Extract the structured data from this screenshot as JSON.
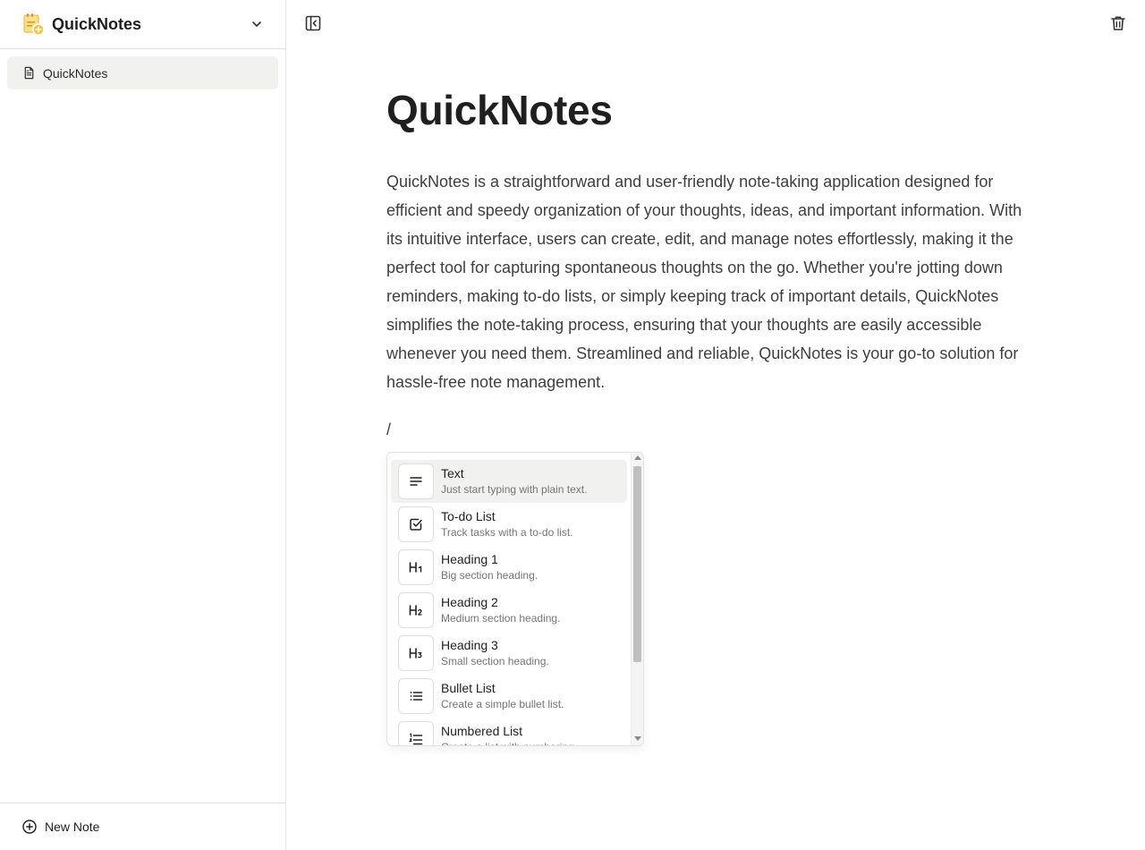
{
  "workspace": {
    "name": "QuickNotes",
    "logo_icon": "notebook-logo-icon",
    "accent": "#f4c542"
  },
  "sidebar": {
    "items": [
      {
        "label": "QuickNotes",
        "icon": "document-icon",
        "selected": true
      }
    ],
    "footer": {
      "label": "New Note",
      "icon": "plus-circle-icon"
    }
  },
  "toolbar": {
    "toggle_sidebar_icon": "sidebar-toggle-icon",
    "delete_icon": "trash-icon"
  },
  "document": {
    "title": "QuickNotes",
    "body": "QuickNotes is a straightforward and user-friendly note-taking application designed for efficient and speedy organization of your thoughts, ideas, and important information. With its intuitive interface, users can create, edit, and manage notes effortlessly, making it the perfect tool for capturing spontaneous thoughts on the go. Whether you're jotting down reminders, making to-do lists, or simply keeping track of important details, QuickNotes simplifies the note-taking process, ensuring that your thoughts are easily accessible whenever you need them. Streamlined and reliable, QuickNotes is your go-to solution for hassle-free note management.",
    "current_input": "/"
  },
  "slash_menu": {
    "items": [
      {
        "title": "Text",
        "description": "Just start typing with plain text.",
        "icon": "text-align-icon",
        "active": true
      },
      {
        "title": "To-do List",
        "description": "Track tasks with a to-do list.",
        "icon": "checkbox-icon",
        "active": false
      },
      {
        "title": "Heading 1",
        "description": "Big section heading.",
        "icon": "heading-1-icon",
        "active": false
      },
      {
        "title": "Heading 2",
        "description": "Medium section heading.",
        "icon": "heading-2-icon",
        "active": false
      },
      {
        "title": "Heading 3",
        "description": "Small section heading.",
        "icon": "heading-3-icon",
        "active": false
      },
      {
        "title": "Bullet List",
        "description": "Create a simple bullet list.",
        "icon": "bullet-list-icon",
        "active": false
      },
      {
        "title": "Numbered List",
        "description": "Create a list with numbering.",
        "icon": "numbered-list-icon",
        "active": false
      }
    ]
  }
}
